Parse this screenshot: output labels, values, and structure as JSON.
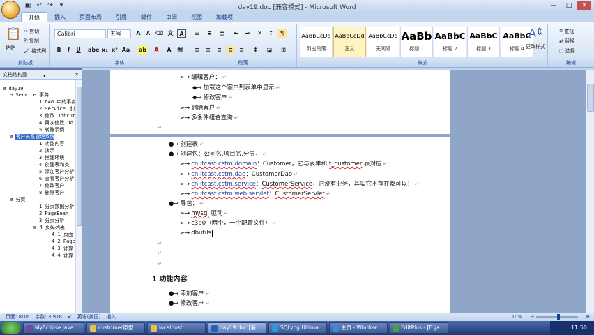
{
  "window": {
    "title": "day19.doc [兼容模式] - Microsoft Word"
  },
  "tabs": [
    "开始",
    "插入",
    "页面布局",
    "引用",
    "邮件",
    "审阅",
    "视图",
    "加载项"
  ],
  "ribbon": {
    "paste": "粘贴",
    "cut": "剪切",
    "copy": "复制",
    "format_painter": "格式刷",
    "clipboard_label": "剪贴板",
    "font_name": "Calibri",
    "font_size": "五号",
    "font_label": "字体",
    "paragraph_label": "段落",
    "styles_label": "样式",
    "editing_label": "编辑",
    "find": "查找",
    "replace": "替换",
    "select": "选择",
    "change_styles": "更改样式",
    "styles": [
      {
        "sample": "AaBbCcDd",
        "name": "列出段落"
      },
      {
        "sample": "AaBbCcDd",
        "name": "正文"
      },
      {
        "sample": "AaBbCcDd",
        "name": "无间隔"
      },
      {
        "sample": "AaBb",
        "name": "标题 1"
      },
      {
        "sample": "AaBbC",
        "name": "标题 2"
      },
      {
        "sample": "AaBbC",
        "name": "标题 3"
      },
      {
        "sample": "AaBbC",
        "name": "标题 4"
      }
    ]
  },
  "nav": {
    "title": "文档结构图",
    "items": [
      "day19",
      "Service 事务",
      "1  DAO 中的事务",
      "2  Service 才是",
      "3  修改 JdbcUt",
      "4  再次修改 Jd",
      "5  转账示例",
      "客户关系管理系统",
      "1  功能内容",
      "2  演示",
      "3  搭建环境",
      "4  创建表和类",
      "5  添加客户分析",
      "6  查看客户分析",
      "7  修改客户",
      "8  删除客户",
      "分页",
      "1  分页数据分析",
      "2  PageBean",
      "3  分页分析",
      "4  页码列表",
      "4.1  页面",
      "4.2  Page",
      "4.3  计算",
      "4.4  计算"
    ]
  },
  "doc": {
    "page1": [
      "编辑客户：",
      "加载这个客户到表单中显示",
      "修改客户",
      "删除客户",
      "多条件组合查询"
    ],
    "page2": {
      "create_table": "创建表",
      "create_package": "创建包：公司名.项目名.分层，",
      "pkg_domain": "cn.itcast.cstm.domain",
      "pkg_domain_desc_a": "：Customer，它与表单和 ",
      "pkg_domain_table": "t_customer",
      "pkg_domain_desc_b": " 表对应",
      "pkg_dao": "cn.itcast.cstm.dao",
      "pkg_dao_desc": "：CustomerDao",
      "pkg_service": "cn.itcast.cstm.service",
      "pkg_service_desc_a": "：",
      "pkg_service_class": "CustomerService",
      "pkg_service_desc_b": "，它没有业务，其实它不存在都可以！",
      "pkg_servlet": "cn.itcast.cstm.web.servlet",
      "pkg_servlet_desc_a": "：",
      "pkg_servlet_class": "CustomerServlet",
      "import_jars": "导包：",
      "jar_mysql_a": "mysql",
      "jar_mysql_b": " 驱动",
      "jar_c3p0": "c3p0（两个，一个配置文件）",
      "jar_dbutils": "dbutils",
      "heading": "1  功能内容",
      "add_customer": "添加客户",
      "edit_customer": "修改客户"
    }
  },
  "status": {
    "page": "页面: 8/16",
    "words": "字数: 3,978",
    "lang": "英语(美国)",
    "mode": "插入",
    "zoom": "110%"
  },
  "taskbar": {
    "items": [
      "MyEclipse Java...",
      "customer原型",
      "localhost",
      "day19.doc [兼...",
      "SQLyog Ultima...",
      "主页 - Window...",
      "EditPlus - [F:\\Ja..."
    ],
    "time": "11:50"
  },
  "colors": {
    "accent": "#3169c6",
    "ribbon": "#d6e4f5",
    "taskbar": "#1c3a78"
  }
}
